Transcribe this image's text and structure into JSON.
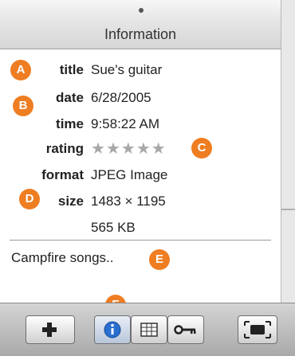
{
  "panel": {
    "title": "Information"
  },
  "fields": [
    {
      "label": "title",
      "value": "Sue's guitar"
    },
    {
      "label": "date",
      "value": "6/28/2005"
    },
    {
      "label": "time",
      "value": "9:58:22 AM"
    },
    {
      "label": "rating",
      "stars": 5,
      "rating_value": 0
    },
    {
      "label": "format",
      "value": "JPEG Image"
    },
    {
      "label": "size",
      "value": "1483 × 1195"
    },
    {
      "label": "",
      "value": "565 KB"
    }
  ],
  "comment": "Campfire songs..",
  "callouts": [
    "A",
    "B",
    "C",
    "D",
    "E",
    "F"
  ],
  "toolbar": {
    "buttons": [
      {
        "name": "add-button",
        "icon": "plus-icon"
      },
      {
        "name": "info-button",
        "icon": "info-icon",
        "selected": true
      },
      {
        "name": "table-button",
        "icon": "table-icon"
      },
      {
        "name": "keywords-button",
        "icon": "key-icon"
      },
      {
        "name": "fullscreen-button",
        "icon": "fullscreen-icon"
      }
    ]
  },
  "colors": {
    "callout": "#ef7d22",
    "info_icon": "#2a6fd0",
    "stars": "#a8a8a8"
  }
}
